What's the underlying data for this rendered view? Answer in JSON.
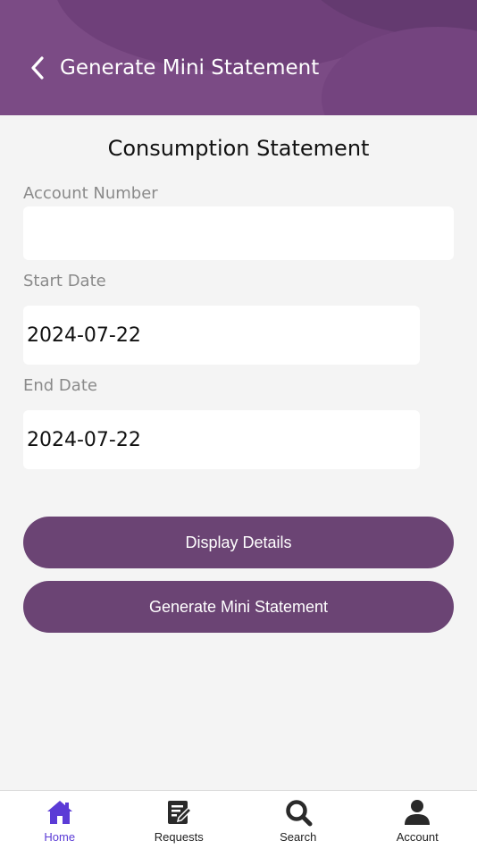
{
  "header": {
    "title": "Generate Mini Statement"
  },
  "form": {
    "section_title": "Consumption Statement",
    "account_number": {
      "label": "Account Number",
      "value": "",
      "placeholder": ""
    },
    "start_date": {
      "label": "Start Date",
      "value": "2024-07-22"
    },
    "end_date": {
      "label": "End Date",
      "value": "2024-07-22"
    }
  },
  "actions": {
    "display_details_label": "Display Details",
    "generate_label": "Generate Mini Statement"
  },
  "bottom_nav": {
    "items": [
      {
        "label": "Home",
        "icon": "home-icon",
        "active": true
      },
      {
        "label": "Requests",
        "icon": "edit-document-icon",
        "active": false
      },
      {
        "label": "Search",
        "icon": "search-icon",
        "active": false
      },
      {
        "label": "Account",
        "icon": "user-icon",
        "active": false
      }
    ]
  },
  "colors": {
    "header_bg": "#7b4b85",
    "button_bg": "#6b4474",
    "active_nav": "#5b3bd6",
    "page_bg": "#f4f4f4"
  }
}
